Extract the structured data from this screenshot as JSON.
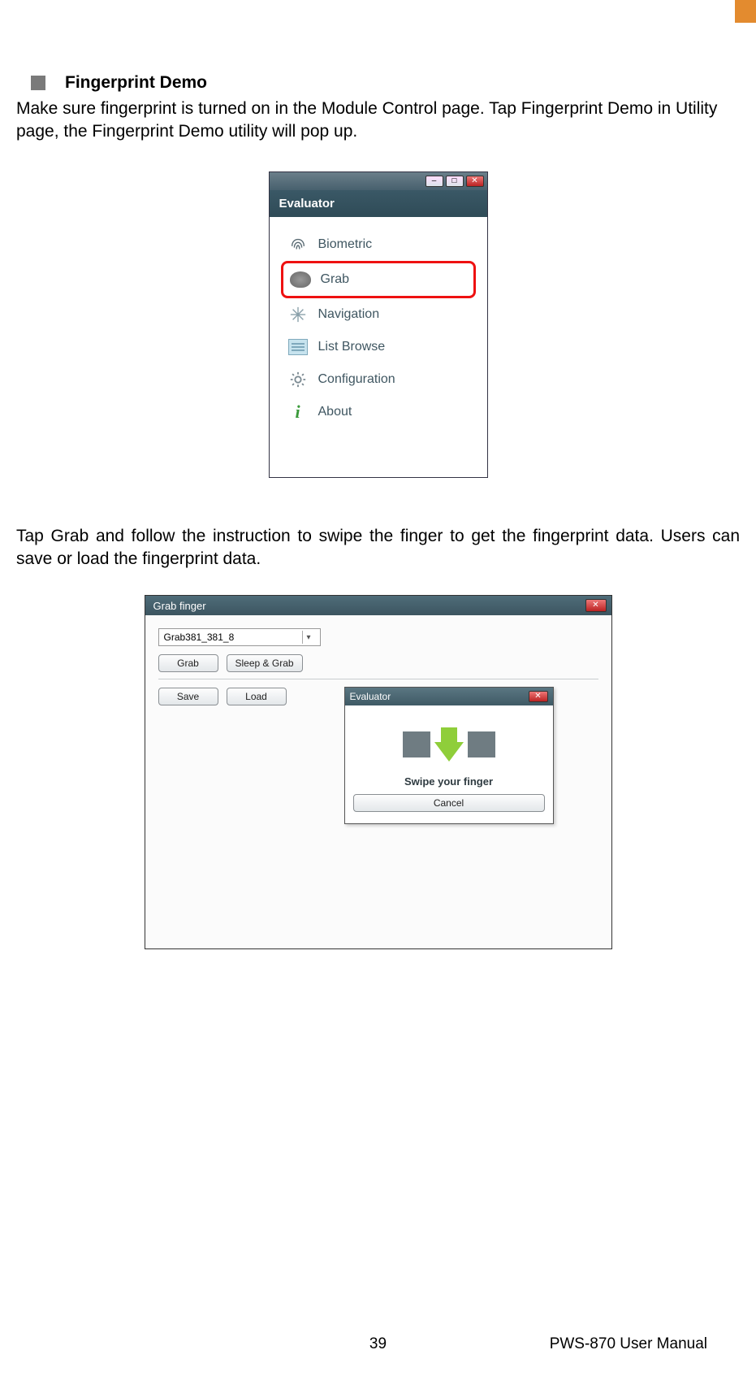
{
  "section": {
    "title": "Fingerprint Demo",
    "para1": "Make sure fingerprint is turned on in the Module Control page. Tap Fingerprint Demo in Utility page, the Fingerprint Demo utility will pop up.",
    "para2": "Tap Grab and follow the instruction to swipe the finger to get the fingerprint data. Users can save or load the fingerprint data."
  },
  "evaluator_window": {
    "title": "Evaluator",
    "items": [
      {
        "label": "Biometric"
      },
      {
        "label": "Grab",
        "highlighted": true
      },
      {
        "label": "Navigation"
      },
      {
        "label": "List Browse"
      },
      {
        "label": "Configuration"
      },
      {
        "label": "About"
      }
    ]
  },
  "grab_window": {
    "title": "Grab finger",
    "combo_value": "Grab381_381_8",
    "buttons": {
      "grab": "Grab",
      "sleep_grab": "Sleep & Grab",
      "save": "Save",
      "load": "Load"
    },
    "swipe_dialog": {
      "title": "Evaluator",
      "prompt": "Swipe your finger",
      "cancel": "Cancel"
    }
  },
  "footer": {
    "page_number": "39",
    "manual": "PWS-870 User Manual"
  }
}
